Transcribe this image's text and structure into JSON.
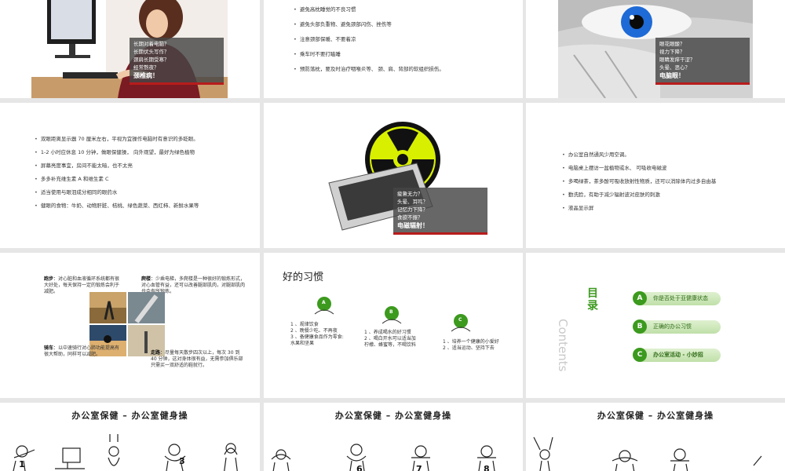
{
  "slide1": {
    "caption_lines": [
      "长期对着电脑？",
      "长期伏头写作？",
      "颈肩长期受寒？",
      "经常熬夜？"
    ],
    "caption_highlight": "颈椎病！"
  },
  "slide2": {
    "bullets": [
      "避免高枕睡觉的不良习惯",
      "避免头部负重物、避免颈部闪伤、挫伤等",
      "注意颈部保暖、不要着凉",
      "乘车时不要打瞌睡",
      "预防落枕，要及时治疗咽喉炎等、 颈、肩、背部的软组织损伤。"
    ]
  },
  "slide3": {
    "caption_lines": [
      "眼花眼酸？",
      "视力下降？",
      "眼睛发痒干涩？",
      "头晕、恶心？"
    ],
    "caption_highlight": "电脑眼！"
  },
  "slide4": {
    "bullets": [
      "双眼距离显示器 70 厘米左右，平视为宜操作电脑时有意识的多眨眼。",
      "1-2 小时应休息 10 分钟，做眼保健操， 向外观望，最好为绿色植物",
      "屏幕亮度事宜，房间不能太暗，也不太亮",
      "多多补充维生素 A 和维生素 C",
      "适当使用与眼泪成分相同的眼药水",
      "健眼的食物：牛奶、动物肝脏、桔桃、绿色蔬菜、西红柿、新鲜水果等"
    ]
  },
  "slide5": {
    "caption_lines": [
      "疲惫无力？",
      "头晕、耳鸣？",
      "记忆力下降？",
      "食欲不振？"
    ],
    "caption_highlight": "电磁辐射！"
  },
  "slide6": {
    "bullets": [
      "办公室自然通风少用空调。",
      "电脑桌上摆访一盆植物或水、 可吸收电磁波",
      "多喝绿茶，茶多酚可吸收放射性物质，还可以消除体内过多自由基",
      "勤洗脸，有助于减少辐射波对皮肤的刺激",
      "液晶显示屏"
    ]
  },
  "slide7": {
    "run_label": "跑步",
    "run_text": "：对心脏和血液循环系统都有很大好处，每天保持一定的锻炼会利于减肥。",
    "climb_label": "爬楼",
    "climb_text": "：少乘电梯，多爬楼是一种很好的锻炼形式，对心血管有益，还可以改善腿部肌肉，对腿部肌肉也会有所锻炼。",
    "bike_label": "骑车",
    "bike_text": "：以中速骑行对心肺功能提高有很大帮助，同样可以减肥。",
    "walk_label": "走路",
    "walk_text": "：尽量每天散步四次以上，每次 30 到 40 分钟，这对身体很有益，无需参加俱乐部只需买一双舒适的鞋就行。"
  },
  "slide8": {
    "title": "好的习惯",
    "items": [
      {
        "badge": "A",
        "lines": [
          "1 、规律饮食",
          "2 、晚餐少吃、不再夜",
          "3 、备健康食品作为零食:",
          "水果和坚果"
        ]
      },
      {
        "badge": "B",
        "lines": [
          "1 、养成喝水的好习惯",
          "2 、喝白开水可以适当加",
          "柠檬、蜂蜜等，不喝饮料"
        ]
      },
      {
        "badge": "C",
        "lines": [
          "1 、培养一个健康的小爱好",
          "2 、适当运动、坚持下去"
        ]
      }
    ]
  },
  "slide9": {
    "heading": "目录",
    "watermark": "Contents",
    "items": [
      {
        "badge": "A",
        "label": "你是否处于亚健康状态"
      },
      {
        "badge": "B",
        "label": "正确的办公习惯"
      },
      {
        "badge": "C",
        "label": "办公室活动 - 小妙招"
      }
    ]
  },
  "exercise_title": "办公室保健 – 办公室健身操",
  "slide10": {
    "nums": [
      "1",
      "3"
    ]
  },
  "slide11": {
    "nums": [
      "6",
      "7",
      "8"
    ]
  },
  "colors": {
    "accent_red": "#b81c1c",
    "green": "#3c9a1e",
    "radiation_yellow": "#d8f000"
  }
}
